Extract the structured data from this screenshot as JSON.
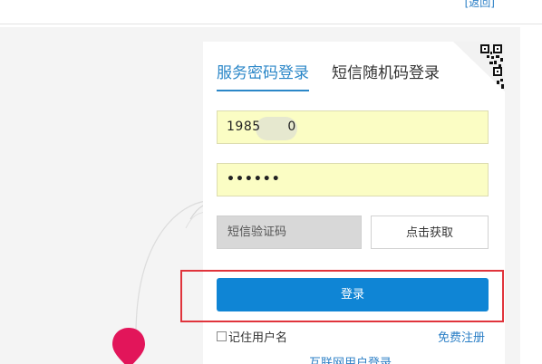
{
  "header": {
    "link": "[返回]"
  },
  "tabs": [
    {
      "label": "服务密码登录",
      "active": true
    },
    {
      "label": "短信随机码登录",
      "active": false
    }
  ],
  "form": {
    "phone_value": "1985      0",
    "password_value": "••••••",
    "sms_code_placeholder": "短信验证码",
    "get_code_label": "点击获取",
    "login_label": "登录",
    "remember_label": "记住用户名",
    "register_label": "免费注册",
    "internet_login_label": "互联网用户登录"
  },
  "colors": {
    "accent": "#2b87c8",
    "login_button": "#0f85d5",
    "input_background": "#fbfdc4",
    "highlight_border": "#e0343c",
    "map_pin": "#e2155a"
  },
  "icons": [
    "qr-code-icon",
    "map-pin-icon",
    "checkbox-icon"
  ]
}
